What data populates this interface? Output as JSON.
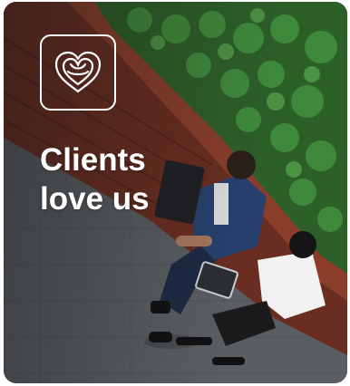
{
  "card": {
    "headline_line1": "Clients",
    "headline_line2": "love us",
    "icon": "heart-knot-icon",
    "photo": "business-people-seated-on-bench-photo"
  },
  "colors": {
    "text": "#ffffff",
    "foliage": "#2f6a2c",
    "bench": "#6e2f22",
    "pavement": "#595d61"
  }
}
